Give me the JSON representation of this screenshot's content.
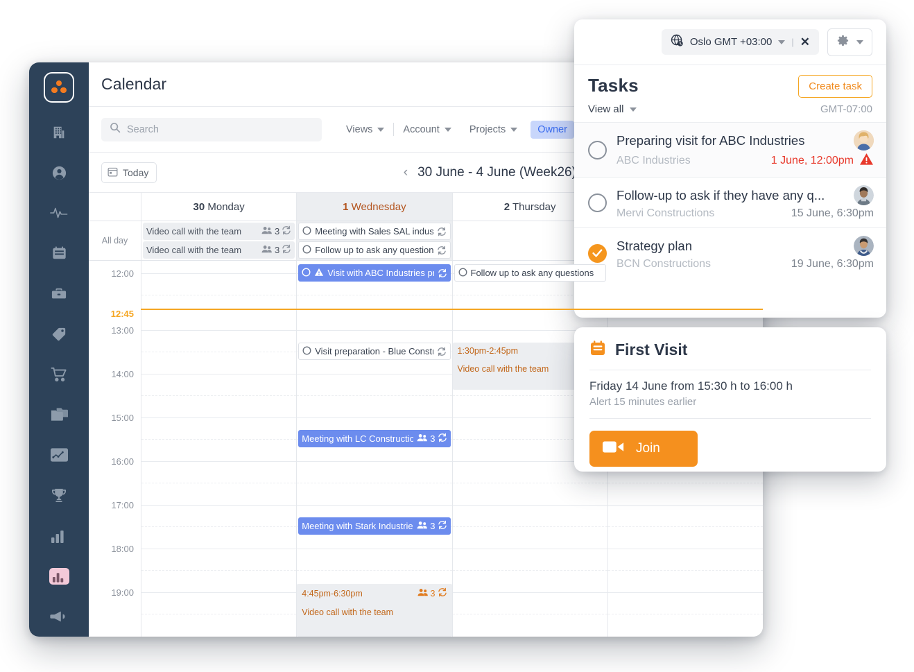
{
  "app": {
    "page_title": "Calendar",
    "logo_name": "three-dots-logo"
  },
  "sidebar": {
    "items": [
      {
        "icon": "building-icon",
        "name": "sidebar-item-companies"
      },
      {
        "icon": "person-icon",
        "name": "sidebar-item-contacts"
      },
      {
        "icon": "activity-pulse-icon",
        "name": "sidebar-item-activity"
      },
      {
        "icon": "calendar-icon",
        "name": "sidebar-item-calendar"
      },
      {
        "icon": "briefcase-icon",
        "name": "sidebar-item-deals"
      },
      {
        "icon": "tag-icon",
        "name": "sidebar-item-tags"
      },
      {
        "icon": "shopping-cart-icon",
        "name": "sidebar-item-orders"
      },
      {
        "icon": "folders-icon",
        "name": "sidebar-item-documents"
      },
      {
        "icon": "chart-card-icon",
        "name": "sidebar-item-insights"
      },
      {
        "icon": "trophy-icon",
        "name": "sidebar-item-goals"
      },
      {
        "icon": "bar-chart-icon",
        "name": "sidebar-item-reports"
      },
      {
        "icon": "bar-chart-highlight-icon",
        "name": "sidebar-item-analytics"
      },
      {
        "icon": "megaphone-icon",
        "name": "sidebar-item-campaigns"
      }
    ]
  },
  "toolbar": {
    "search_placeholder": "Search",
    "menus": [
      "Views",
      "Account",
      "Projects"
    ],
    "owner_chip": "Owner"
  },
  "datebar": {
    "today_label": "Today",
    "prev": "‹",
    "next": "›",
    "week_label": "30 June - 4 June (Week26)"
  },
  "calendar": {
    "allday_label": "All day",
    "days": [
      {
        "num": "30",
        "name": "Monday",
        "today": false
      },
      {
        "num": "1",
        "name": "Wednesday",
        "today": true
      },
      {
        "num": "2",
        "name": "Thursday",
        "today": false
      },
      {
        "num": "",
        "name": "",
        "today": false
      }
    ],
    "hours": [
      "12:00",
      "13:00",
      "14:00",
      "15:00",
      "16:00",
      "17:00",
      "18:00",
      "19:00"
    ],
    "now_time": "12:45",
    "now_color": "#f5a623",
    "allday_events": {
      "monday": [
        {
          "title": "Video call with the team",
          "attendees": "3",
          "style": "grey"
        },
        {
          "title": "Video call with the team",
          "attendees": "3",
          "style": "grey"
        }
      ],
      "wednesday": [
        {
          "title": "Meeting with Sales SAL industries",
          "style": "outline"
        },
        {
          "title": "Follow up to ask any questions",
          "style": "outline"
        }
      ]
    },
    "timed_events": {
      "wednesday": [
        {
          "title": "Visit with ABC Industries preparation",
          "style": "blue",
          "warning": true,
          "at": "12:00"
        },
        {
          "title": "Visit preparation - Blue Constructions",
          "style": "outline",
          "at": "13:30"
        },
        {
          "title": "Meeting with LC Constructions",
          "attendees": "3",
          "style": "blue",
          "at": "15:30"
        },
        {
          "title": "Meeting with Stark Industries",
          "attendees": "3",
          "style": "blue",
          "at": "17:15"
        },
        {
          "time_range": "4:45pm-6:30pm",
          "title": "Video call with the team",
          "attendees": "3",
          "style": "block",
          "at": "19:00"
        }
      ],
      "thursday": [
        {
          "title": "Follow up to ask any questions",
          "style": "outline",
          "at": "12:00"
        },
        {
          "time_range": "1:30pm-2:45pm",
          "title": "Video call with the team",
          "style": "block",
          "at": "13:30"
        }
      ]
    }
  },
  "tasks_panel": {
    "timezone_chip": "Oslo GMT +03:00",
    "timezone_close": "✕",
    "title": "Tasks",
    "create_label": "Create task",
    "view_all_label": "View all",
    "gmt_label": "GMT-07:00",
    "items": [
      {
        "name": "Preparing visit for ABC Industries",
        "company": "ABC Industries",
        "date": "1 June, 12:00pm",
        "done": false,
        "urgent": true,
        "avatar_color": "#e8c39a"
      },
      {
        "name": "Follow-up to ask if they have any q...",
        "company": "Mervi Constructions",
        "date": "15 June, 6:30pm",
        "done": false,
        "urgent": false,
        "avatar_color": "#6b5b4a"
      },
      {
        "name": "Strategy plan",
        "company": "BCN Constructions",
        "date": "19 June, 6:30pm",
        "done": true,
        "urgent": false,
        "avatar_color": "#4a5568"
      }
    ]
  },
  "visit_card": {
    "title": "First Visit",
    "when": "Friday 14 June from 15:30 h to 16:00 h",
    "alert": "Alert 15 minutes earlier",
    "join_label": "Join"
  },
  "colors": {
    "accent_orange": "#f5901e",
    "event_blue": "#6c8cee",
    "sidebar": "#2d4259",
    "urgent_red": "#e8392b"
  }
}
